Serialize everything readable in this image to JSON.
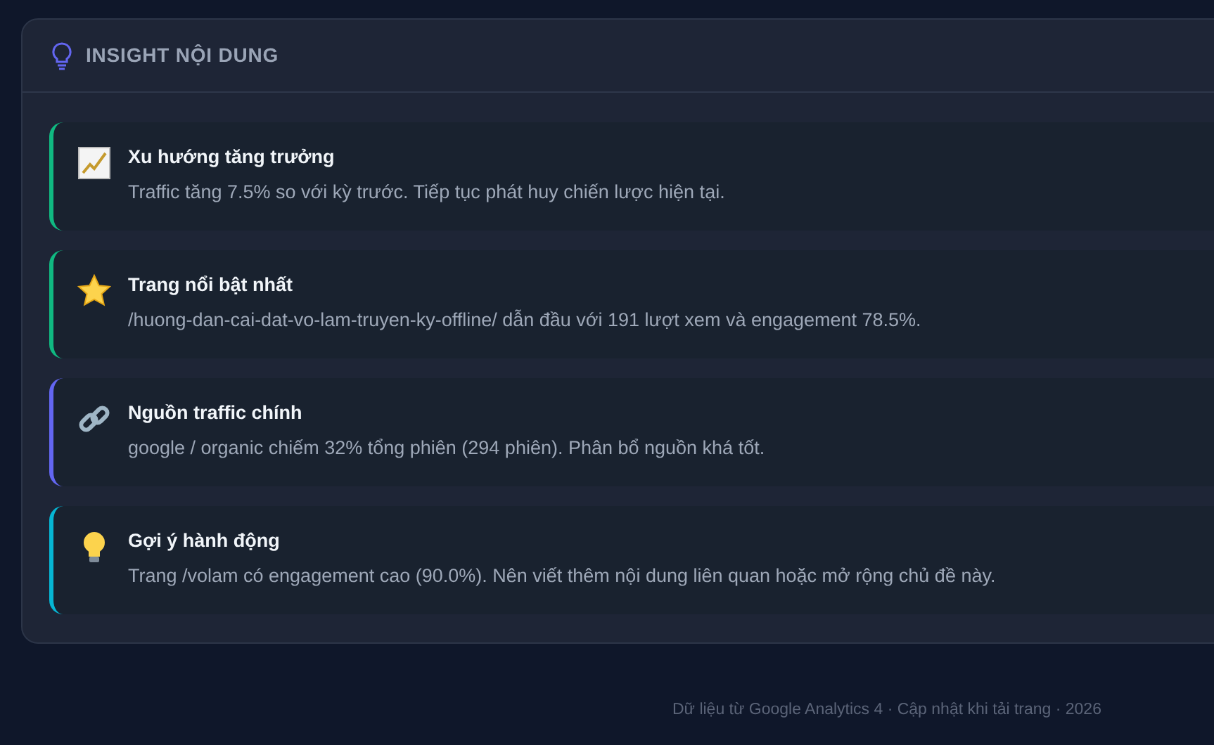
{
  "panel": {
    "title": "INSIGHT NỘI DUNG"
  },
  "insights": [
    {
      "title": "Xu hướng tăng trưởng",
      "text": "Traffic tăng 7.5% so với kỳ trước. Tiếp tục phát huy chiến lược hiện tại.",
      "color": "#10b981"
    },
    {
      "title": "Trang nổi bật nhất",
      "text": "/huong-dan-cai-dat-vo-lam-truyen-ky-offline/ dẫn đầu với 191 lượt xem và engagement 78.5%.",
      "color": "#10b981"
    },
    {
      "title": "Nguồn traffic chính",
      "text": "google / organic chiếm 32% tổng phiên (294 phiên). Phân bổ nguồn khá tốt.",
      "color": "#6366f1"
    },
    {
      "title": "Gợi ý hành động",
      "text": "Trang /volam có engagement cao (90.0%). Nên viết thêm nội dung liên quan hoặc mở rộng chủ đề này.",
      "color": "#06b6d4"
    }
  ],
  "footer": "Dữ liệu từ Google Analytics 4 · Cập nhật khi tải trang · 2026"
}
